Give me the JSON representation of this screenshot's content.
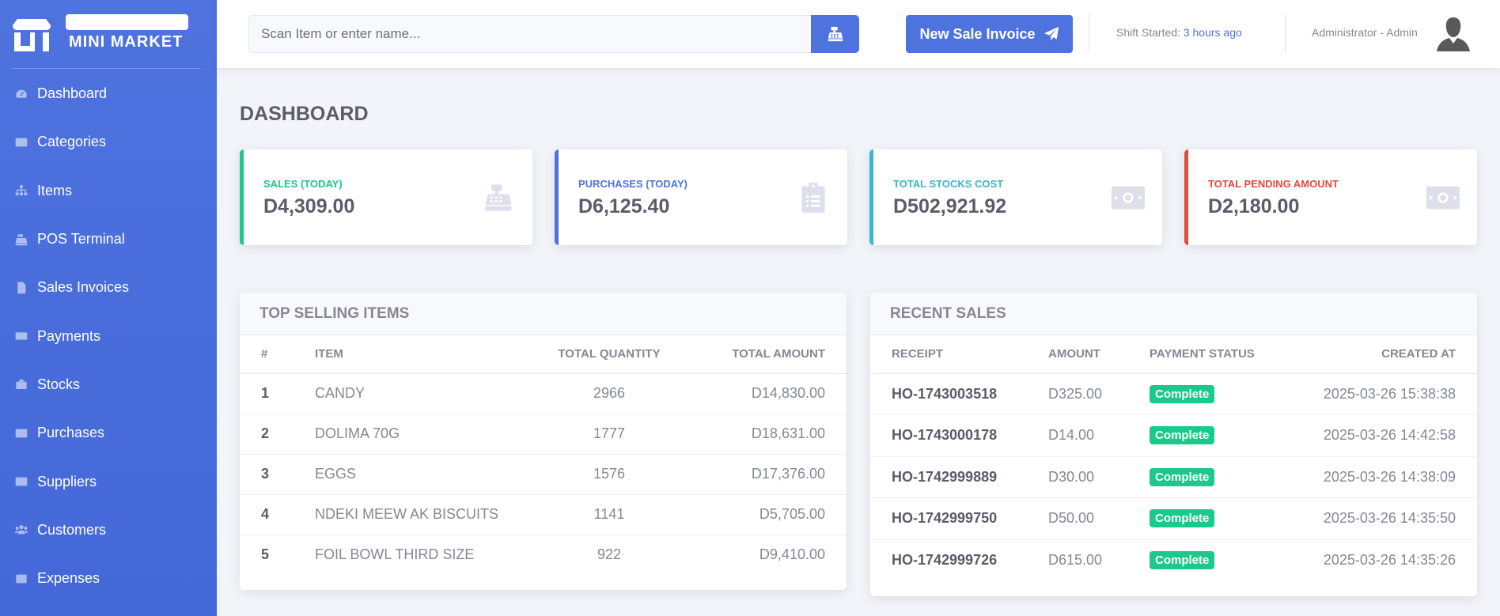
{
  "brand": {
    "name": "MINI MARKET"
  },
  "sidebar": {
    "items": [
      {
        "label": "Dashboard",
        "icon": "tachometer-icon"
      },
      {
        "label": "Categories",
        "icon": "list-icon"
      },
      {
        "label": "Items",
        "icon": "sitemap-icon"
      },
      {
        "label": "POS Terminal",
        "icon": "cash-register-icon"
      },
      {
        "label": "Sales Invoices",
        "icon": "file-invoice-icon"
      },
      {
        "label": "Payments",
        "icon": "money-bill-icon"
      },
      {
        "label": "Stocks",
        "icon": "briefcase-icon"
      },
      {
        "label": "Purchases",
        "icon": "list-alt-icon"
      },
      {
        "label": "Suppliers",
        "icon": "address-card-icon"
      },
      {
        "label": "Customers",
        "icon": "users-icon"
      },
      {
        "label": "Expenses",
        "icon": "wallet-icon"
      }
    ]
  },
  "topbar": {
    "search_placeholder": "Scan Item or enter name...",
    "new_sale_label": "New Sale Invoice",
    "shift_label": "Shift Started:",
    "shift_value": "3 hours ago",
    "user_label": "Administrator - Admin"
  },
  "page": {
    "title": "DASHBOARD"
  },
  "cards": [
    {
      "label": "SALES (TODAY)",
      "value": "D4,309.00",
      "color": "#1cc88a",
      "icon": "cash-register-icon"
    },
    {
      "label": "PURCHASES (TODAY)",
      "value": "D6,125.40",
      "color": "#4e73df",
      "icon": "clipboard-list-icon"
    },
    {
      "label": "TOTAL STOCKS COST",
      "value": "D502,921.92",
      "color": "#36b9cc",
      "icon": "money-bill-icon"
    },
    {
      "label": "TOTAL PENDING AMOUNT",
      "value": "D2,180.00",
      "color": "#e74a3b",
      "icon": "money-bill-icon"
    }
  ],
  "top_selling": {
    "title": "TOP SELLING ITEMS",
    "headers": [
      "#",
      "ITEM",
      "TOTAL QUANTITY",
      "TOTAL AMOUNT"
    ],
    "rows": [
      [
        "1",
        "CANDY",
        "2966",
        "D14,830.00"
      ],
      [
        "2",
        "DOLIMA 70G",
        "1777",
        "D18,631.00"
      ],
      [
        "3",
        "EGGS",
        "1576",
        "D17,376.00"
      ],
      [
        "4",
        "NDEKI MEEW AK BISCUITS",
        "1141",
        "D5,705.00"
      ],
      [
        "5",
        "FOIL BOWL THIRD SIZE",
        "922",
        "D9,410.00"
      ]
    ]
  },
  "recent_sales": {
    "title": "RECENT SALES",
    "headers": [
      "RECEIPT",
      "AMOUNT",
      "PAYMENT STATUS",
      "CREATED AT"
    ],
    "rows": [
      [
        "HO-1743003518",
        "D325.00",
        "Complete",
        "2025-03-26 15:38:38"
      ],
      [
        "HO-1743000178",
        "D14.00",
        "Complete",
        "2025-03-26 14:42:58"
      ],
      [
        "HO-1742999889",
        "D30.00",
        "Complete",
        "2025-03-26 14:38:09"
      ],
      [
        "HO-1742999750",
        "D50.00",
        "Complete",
        "2025-03-26 14:35:50"
      ],
      [
        "HO-1742999726",
        "D615.00",
        "Complete",
        "2025-03-26 14:35:26"
      ]
    ]
  }
}
